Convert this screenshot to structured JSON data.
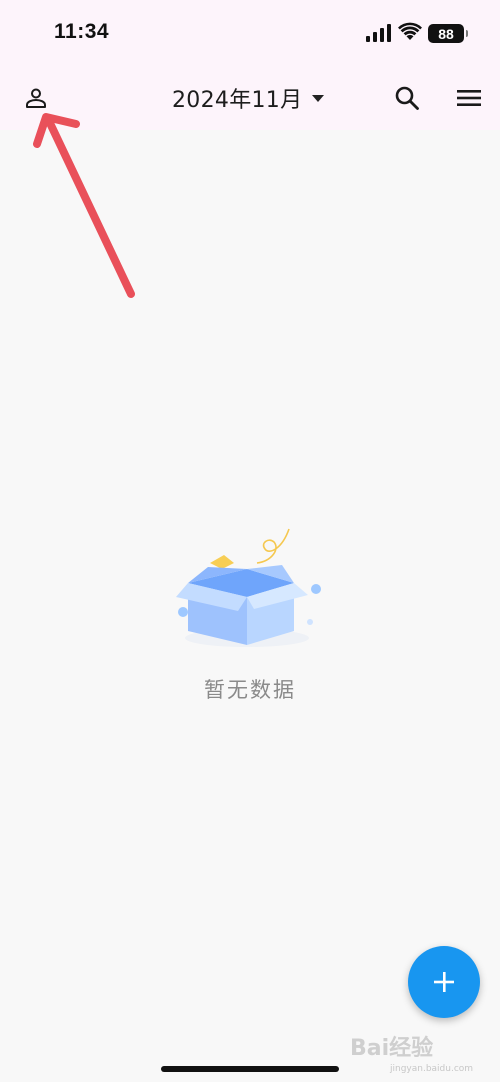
{
  "status_bar": {
    "time": "11:34",
    "battery": "88",
    "icons": [
      "cellular-signal-icon",
      "wifi-icon",
      "battery-icon"
    ]
  },
  "app_bar": {
    "month": "2024年11月",
    "icons": [
      "person-icon",
      "caret-down-icon",
      "search-icon",
      "menu-icon"
    ]
  },
  "empty_state": {
    "text": "暂无数据",
    "illustration": "empty-box"
  },
  "fab": {
    "icon": "plus-icon"
  },
  "watermark": {
    "text": "Bai经验",
    "sub": "jingyan.baidu.com"
  },
  "colors": {
    "bar_bg": "#fdf4fb",
    "page_bg": "#f8f8f8",
    "fab": "#1896f0",
    "annotation_arrow": "#e9505a"
  }
}
